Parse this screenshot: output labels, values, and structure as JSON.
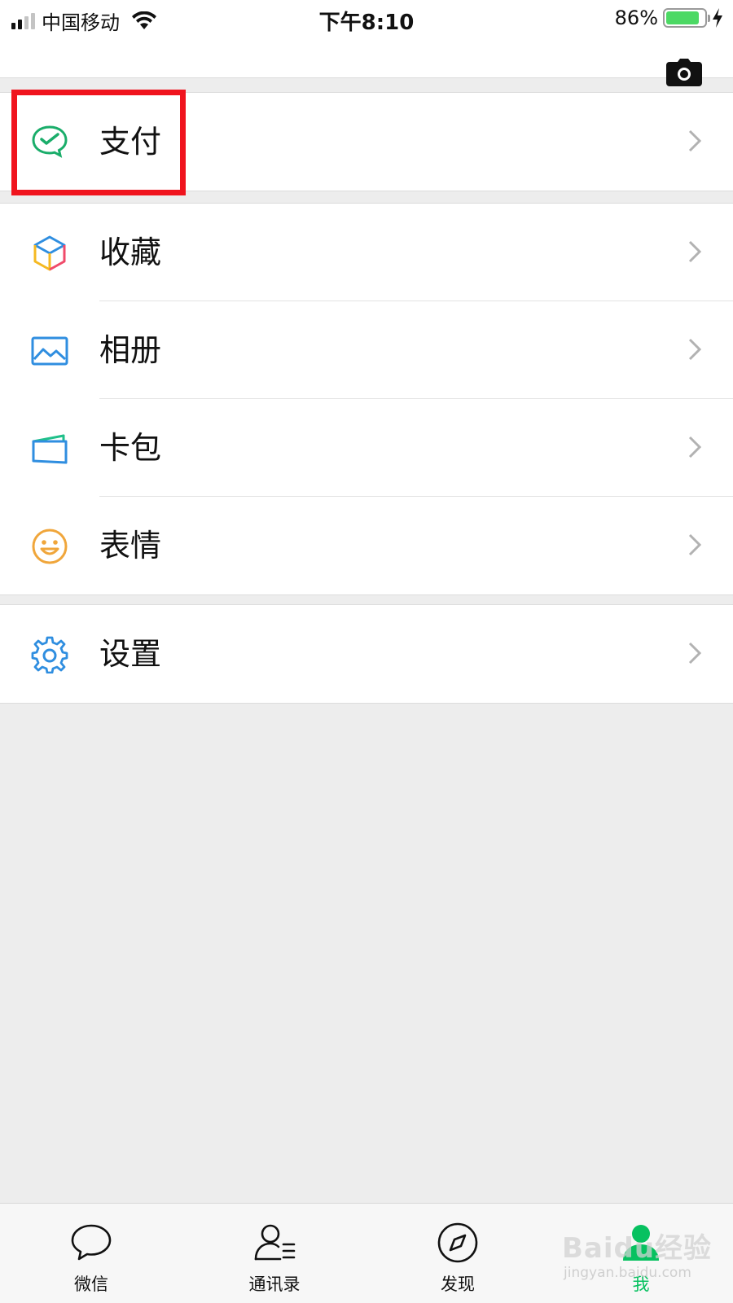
{
  "status_bar": {
    "carrier": "中国移动",
    "time": "下午8:10",
    "battery_percent": "86%",
    "battery_level": 0.86,
    "signal_bars_active": 2,
    "icons": [
      "signal-icon",
      "wifi-icon",
      "battery-icon",
      "charging-bolt-icon"
    ]
  },
  "header": {
    "camera_icon": "camera-icon"
  },
  "groups": [
    {
      "items": [
        {
          "label": "支付",
          "icon": "wechat-pay-icon",
          "highlighted": true
        }
      ]
    },
    {
      "items": [
        {
          "label": "收藏",
          "icon": "favorites-cube-icon"
        },
        {
          "label": "相册",
          "icon": "album-icon"
        },
        {
          "label": "卡包",
          "icon": "card-wallet-icon"
        },
        {
          "label": "表情",
          "icon": "smiley-icon"
        }
      ]
    },
    {
      "items": [
        {
          "label": "设置",
          "icon": "settings-gear-icon"
        }
      ]
    }
  ],
  "tab_bar": {
    "tabs": [
      {
        "label": "微信",
        "icon": "chat-bubble-icon",
        "active": false
      },
      {
        "label": "通讯录",
        "icon": "contacts-icon",
        "active": false
      },
      {
        "label": "发现",
        "icon": "compass-icon",
        "active": false
      },
      {
        "label": "我",
        "icon": "me-person-icon",
        "active": true
      }
    ]
  },
  "watermark": {
    "text": "Baidu经验",
    "sub": "jingyan.baidu.com"
  },
  "colors": {
    "brand_green": "#07c160",
    "highlight_red": "#f0141e",
    "background": "#ededed"
  }
}
